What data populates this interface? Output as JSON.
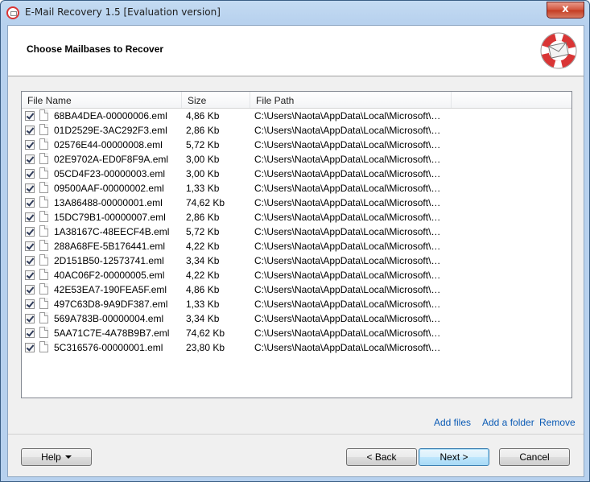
{
  "window": {
    "title": "E-Mail Recovery 1.5 [Evaluation version]",
    "close_label": "x"
  },
  "header": {
    "title": "Choose Mailbases to Recover"
  },
  "table": {
    "columns": [
      "File Name",
      "Size",
      "File Path"
    ],
    "rows": [
      {
        "name": "68BA4DEA-00000006.eml",
        "size": "4,86 Kb",
        "path": "C:\\Users\\Naota\\AppData\\Local\\Microsoft\\Wind...",
        "checked": true
      },
      {
        "name": "01D2529E-3AC292F3.eml",
        "size": "2,86 Kb",
        "path": "C:\\Users\\Naota\\AppData\\Local\\Microsoft\\Wind...",
        "checked": true
      },
      {
        "name": "02576E44-00000008.eml",
        "size": "5,72 Kb",
        "path": "C:\\Users\\Naota\\AppData\\Local\\Microsoft\\Wind...",
        "checked": true
      },
      {
        "name": "02E9702A-ED0F8F9A.eml",
        "size": "3,00 Kb",
        "path": "C:\\Users\\Naota\\AppData\\Local\\Microsoft\\Wind...",
        "checked": true
      },
      {
        "name": "05CD4F23-00000003.eml",
        "size": "3,00 Kb",
        "path": "C:\\Users\\Naota\\AppData\\Local\\Microsoft\\Wind...",
        "checked": true
      },
      {
        "name": "09500AAF-00000002.eml",
        "size": "1,33 Kb",
        "path": "C:\\Users\\Naota\\AppData\\Local\\Microsoft\\Wind...",
        "checked": true
      },
      {
        "name": "13A86488-00000001.eml",
        "size": "74,62 Kb",
        "path": "C:\\Users\\Naota\\AppData\\Local\\Microsoft\\Wind...",
        "checked": true
      },
      {
        "name": "15DC79B1-00000007.eml",
        "size": "2,86 Kb",
        "path": "C:\\Users\\Naota\\AppData\\Local\\Microsoft\\Wind...",
        "checked": true
      },
      {
        "name": "1A38167C-48EECF4B.eml",
        "size": "5,72 Kb",
        "path": "C:\\Users\\Naota\\AppData\\Local\\Microsoft\\Wind...",
        "checked": true
      },
      {
        "name": "288A68FE-5B176441.eml",
        "size": "4,22 Kb",
        "path": "C:\\Users\\Naota\\AppData\\Local\\Microsoft\\Wind...",
        "checked": true
      },
      {
        "name": "2D151B50-12573741.eml",
        "size": "3,34 Kb",
        "path": "C:\\Users\\Naota\\AppData\\Local\\Microsoft\\Wind...",
        "checked": true
      },
      {
        "name": "40AC06F2-00000005.eml",
        "size": "4,22 Kb",
        "path": "C:\\Users\\Naota\\AppData\\Local\\Microsoft\\Wind...",
        "checked": true
      },
      {
        "name": "42E53EA7-190FEA5F.eml",
        "size": "4,86 Kb",
        "path": "C:\\Users\\Naota\\AppData\\Local\\Microsoft\\Wind...",
        "checked": true
      },
      {
        "name": "497C63D8-9A9DF387.eml",
        "size": "1,33 Kb",
        "path": "C:\\Users\\Naota\\AppData\\Local\\Microsoft\\Wind...",
        "checked": true
      },
      {
        "name": "569A783B-00000004.eml",
        "size": "3,34 Kb",
        "path": "C:\\Users\\Naota\\AppData\\Local\\Microsoft\\Wind...",
        "checked": true
      },
      {
        "name": "5AA71C7E-4A78B9B7.eml",
        "size": "74,62 Kb",
        "path": "C:\\Users\\Naota\\AppData\\Local\\Microsoft\\Wind...",
        "checked": true
      },
      {
        "name": "5C316576-00000001.eml",
        "size": "23,80 Kb",
        "path": "C:\\Users\\Naota\\AppData\\Local\\Microsoft\\Wind...",
        "checked": true
      }
    ]
  },
  "actions": {
    "add_files": "Add files",
    "add_folder": "Add a folder",
    "remove": "Remove"
  },
  "footer": {
    "help": "Help",
    "back": "< Back",
    "next": "Next >",
    "cancel": "Cancel"
  },
  "icons": {
    "app": "lifebuoy-envelope-icon",
    "header": "lifebuoy-envelope-icon",
    "file": "file-icon",
    "checkbox": "checkbox-checked-icon"
  },
  "colors": {
    "link": "#0b5bb5",
    "close_button": "#c43b22",
    "lifebuoy_red": "#d93535"
  }
}
